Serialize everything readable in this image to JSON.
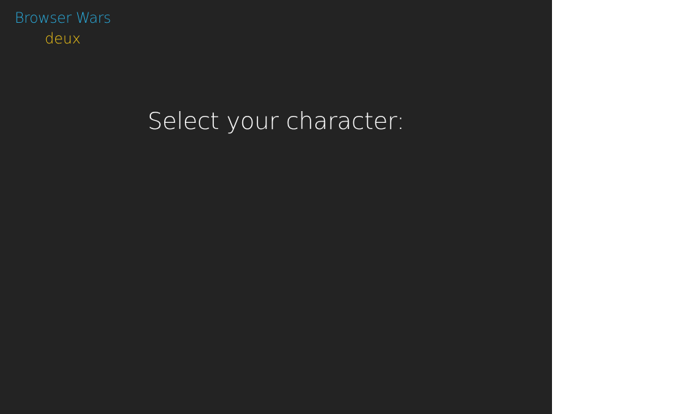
{
  "logo": {
    "title": "Browser Wars",
    "subtitle": "deux"
  },
  "screen": {
    "prompt": "Select your character:"
  },
  "colors": {
    "background": "#232323",
    "logo_title": "#2aa9d9",
    "logo_subtitle": "#f0c419",
    "prompt": "#ffffff"
  }
}
